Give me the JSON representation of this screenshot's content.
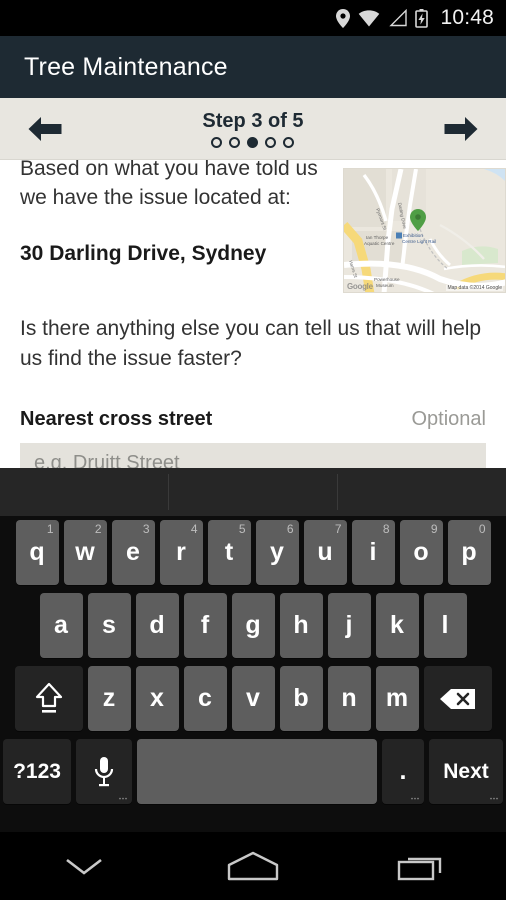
{
  "status_bar": {
    "time": "10:48",
    "icons": [
      "location-pin-icon",
      "wifi-icon",
      "cell-signal-icon",
      "battery-charging-icon"
    ],
    "background": "#000000"
  },
  "app_bar": {
    "title": "Tree Maintenance",
    "background": "#1e2a33",
    "text_color": "#ffffff"
  },
  "step_bar": {
    "back_label": "←",
    "forward_label": "→",
    "step_text": "Step 3 of 5",
    "total_steps": 5,
    "current_step": 3,
    "background": "#e8e6e0"
  },
  "content": {
    "intro_text": "Based on what you have told us we have the issue located at:",
    "address": "30 Darling Drive, Sydney",
    "question": "Is there anything else you can tell us that will help us find the issue faster?",
    "field_label": "Nearest cross street",
    "field_optional": "Optional",
    "field_value": "",
    "field_placeholder": "e.g. Druitt Street"
  },
  "map": {
    "marker": "green-map-marker",
    "marker_color": "#4f9e45",
    "attribution": "Map data ©2014 Google",
    "logo": "Google",
    "labels": [
      "Darling Drive",
      "Harris St",
      "Pyrmont St",
      "Ian Thorpe Aquatic Centre",
      "Exhibition Centre Light Rail",
      "Powerhouse Museum"
    ]
  },
  "keyboard": {
    "suggestions": [
      "",
      "",
      ""
    ],
    "row1": [
      {
        "key": "q",
        "num": "1"
      },
      {
        "key": "w",
        "num": "2"
      },
      {
        "key": "e",
        "num": "3"
      },
      {
        "key": "r",
        "num": "4"
      },
      {
        "key": "t",
        "num": "5"
      },
      {
        "key": "y",
        "num": "6"
      },
      {
        "key": "u",
        "num": "7"
      },
      {
        "key": "i",
        "num": "8"
      },
      {
        "key": "o",
        "num": "9"
      },
      {
        "key": "p",
        "num": "0"
      }
    ],
    "row2": [
      {
        "key": "a"
      },
      {
        "key": "s"
      },
      {
        "key": "d"
      },
      {
        "key": "f"
      },
      {
        "key": "g"
      },
      {
        "key": "h"
      },
      {
        "key": "j"
      },
      {
        "key": "k"
      },
      {
        "key": "l"
      }
    ],
    "row3_letters": [
      {
        "key": "z"
      },
      {
        "key": "x"
      },
      {
        "key": "c"
      },
      {
        "key": "v"
      },
      {
        "key": "b"
      },
      {
        "key": "n"
      },
      {
        "key": "m"
      }
    ],
    "shift_label": "shift-icon",
    "backspace_label": "backspace-icon",
    "symbols_label": "?123",
    "mic_label": "microphone-icon",
    "space_label": "",
    "period_label": ".",
    "enter_label": "Next"
  },
  "nav_bar": {
    "back_label": "hide-keyboard-chevron-icon",
    "home_label": "home-icon",
    "recents_label": "recents-icon"
  }
}
